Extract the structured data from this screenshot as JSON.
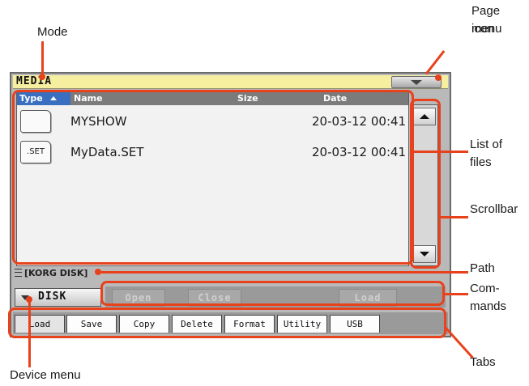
{
  "callouts": {
    "mode": "Mode",
    "page_menu_icon_line1": "Page menu",
    "page_menu_icon_line2": "icon",
    "list_of_files_line1": "List of",
    "list_of_files_line2": "files",
    "scrollbar": "Scrollbar",
    "path": "Path",
    "commands_line1": "Com-",
    "commands_line2": "mands",
    "tabs": "Tabs",
    "device_menu": "Device menu"
  },
  "screen": {
    "mode_title": "MEDIA",
    "columns": {
      "type": "Type",
      "name": "Name",
      "size": "Size",
      "date": "Date"
    },
    "files": [
      {
        "icon_label": "",
        "name": "MYSHOW",
        "date": "20-03-12 00:41"
      },
      {
        "icon_label": ".SET",
        "name": "MyData.SET",
        "date": "20-03-12 00:41"
      }
    ],
    "path": "[KORG DISK]",
    "device": "DISK",
    "commands": {
      "open": "Open",
      "close": "Close",
      "load": "Load"
    },
    "tabs": [
      "Load",
      "Save",
      "Copy",
      "Delete",
      "Format",
      "Utility",
      "USB"
    ],
    "active_tab": "Load"
  },
  "colors": {
    "annotation": "#e8421d",
    "title_bar": "#f6efa0",
    "type_header": "#3a6fc0"
  }
}
